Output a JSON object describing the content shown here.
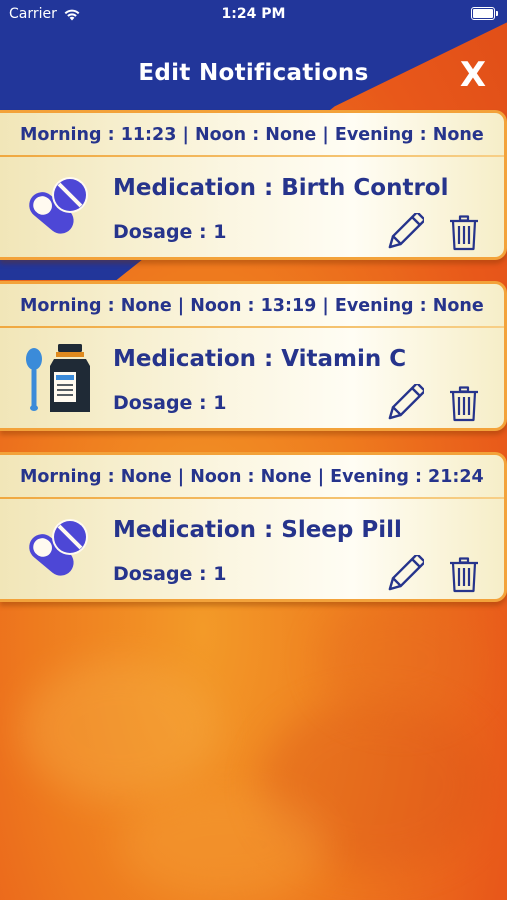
{
  "status_bar": {
    "carrier": "Carrier",
    "time": "1:24 PM"
  },
  "header": {
    "title": "Edit Notifications",
    "close_label": "X"
  },
  "notifications": [
    {
      "schedule": "Morning : 11:23 | Noon : None | Evening : None",
      "medication": "Medication : Birth Control",
      "dosage": "Dosage : 1",
      "icon": "pill-capsule-icon"
    },
    {
      "schedule": "Morning : None | Noon : 13:19 | Evening : None",
      "medication": "Medication : Vitamin C",
      "dosage": "Dosage : 1",
      "icon": "bottle-spoon-icon"
    },
    {
      "schedule": "Morning : None | Noon : None | Evening : 21:24",
      "medication": "Medication : Sleep Pill",
      "dosage": "Dosage : 1",
      "icon": "pill-capsule-icon"
    }
  ],
  "colors": {
    "header_blue": "#22369a",
    "text_navy": "#26348c",
    "accent_orange": "#f3a23a",
    "icon_purple": "#4d47d6"
  }
}
